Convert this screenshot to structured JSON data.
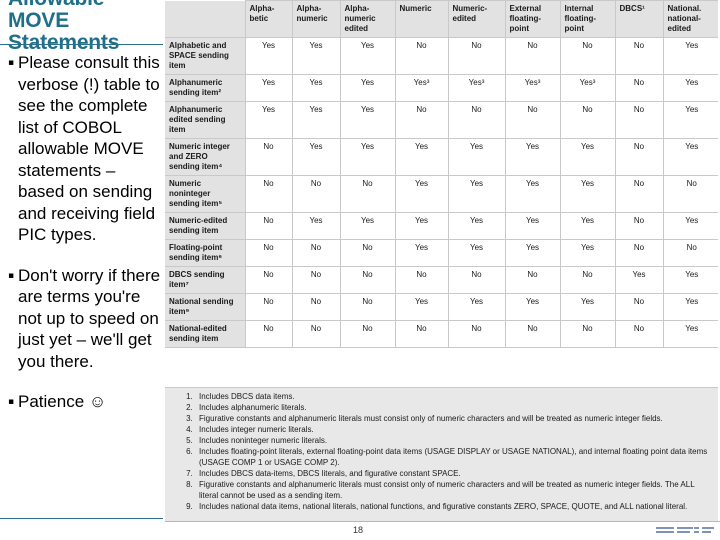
{
  "slide": {
    "title": "Allowable MOVE Statements",
    "page_number": "18",
    "bullet_marker": "▪",
    "bullets": [
      "Please consult this verbose (!) table to see the complete list of COBOL allowable MOVE statements – based on sending and receiving field PIC types.",
      "Don't worry if there are terms you're not up to speed on just yet – we'll get you there.",
      "Patience ☺"
    ],
    "accent_color": "#1F6F8B",
    "logo_name": "ibm-striped-logo"
  },
  "table": {
    "corner_label": "",
    "column_headers": [
      "Alpha-betic",
      "Alpha-numeric",
      "Alpha-numeric edited",
      "Numeric",
      "Numeric-edited",
      "External floating-point",
      "Internal floating-point",
      "DBCS¹",
      "National. national-edited"
    ],
    "rows": [
      {
        "label": "Alphabetic and SPACE sending item",
        "values": [
          "Yes",
          "Yes",
          "Yes",
          "No",
          "No",
          "No",
          "No",
          "No",
          "Yes"
        ]
      },
      {
        "label": "Alphanumeric sending item²",
        "values": [
          "Yes",
          "Yes",
          "Yes",
          "Yes³",
          "Yes³",
          "Yes³",
          "Yes³",
          "No",
          "Yes"
        ]
      },
      {
        "label": "Alphanumeric edited sending item",
        "values": [
          "Yes",
          "Yes",
          "Yes",
          "No",
          "No",
          "No",
          "No",
          "No",
          "Yes"
        ]
      },
      {
        "label": "Numeric integer and ZERO sending item⁴",
        "values": [
          "No",
          "Yes",
          "Yes",
          "Yes",
          "Yes",
          "Yes",
          "Yes",
          "No",
          "Yes"
        ]
      },
      {
        "label": "Numeric noninteger sending item⁵",
        "values": [
          "No",
          "No",
          "No",
          "Yes",
          "Yes",
          "Yes",
          "Yes",
          "No",
          "No"
        ]
      },
      {
        "label": "Numeric-edited sending item",
        "values": [
          "No",
          "Yes",
          "Yes",
          "Yes",
          "Yes",
          "Yes",
          "Yes",
          "No",
          "Yes"
        ]
      },
      {
        "label": "Floating-point sending item⁶",
        "values": [
          "No",
          "No",
          "No",
          "Yes",
          "Yes",
          "Yes",
          "Yes",
          "No",
          "No"
        ]
      },
      {
        "label": "DBCS sending item⁷",
        "values": [
          "No",
          "No",
          "No",
          "No",
          "No",
          "No",
          "No",
          "Yes",
          "Yes"
        ]
      },
      {
        "label": "National sending item⁹",
        "values": [
          "No",
          "No",
          "No",
          "Yes",
          "Yes",
          "Yes",
          "Yes",
          "No",
          "Yes"
        ]
      },
      {
        "label": "National-edited sending item",
        "values": [
          "No",
          "No",
          "No",
          "No",
          "No",
          "No",
          "No",
          "No",
          "Yes"
        ]
      }
    ],
    "footnotes": [
      "Includes DBCS data items.",
      "Includes alphanumeric literals.",
      "Figurative constants and alphanumeric literals must consist only of numeric characters and will be treated as numeric integer fields.",
      "Includes integer numeric literals.",
      "Includes noninteger numeric literals.",
      "Includes floating-point literals, external floating-point data items (USAGE DISPLAY or USAGE NATIONAL), and internal floating point data items (USAGE COMP 1 or USAGE COMP 2).",
      "Includes DBCS data-items, DBCS literals, and figurative constant SPACE.",
      "Figurative constants and alphanumeric literals must consist only of numeric characters and will be treated as numeric integer fields. The ALL literal cannot be used as a sending item.",
      "Includes national data items, national literals, national functions, and figurative constants ZERO, SPACE, QUOTE, and ALL national literal."
    ]
  }
}
